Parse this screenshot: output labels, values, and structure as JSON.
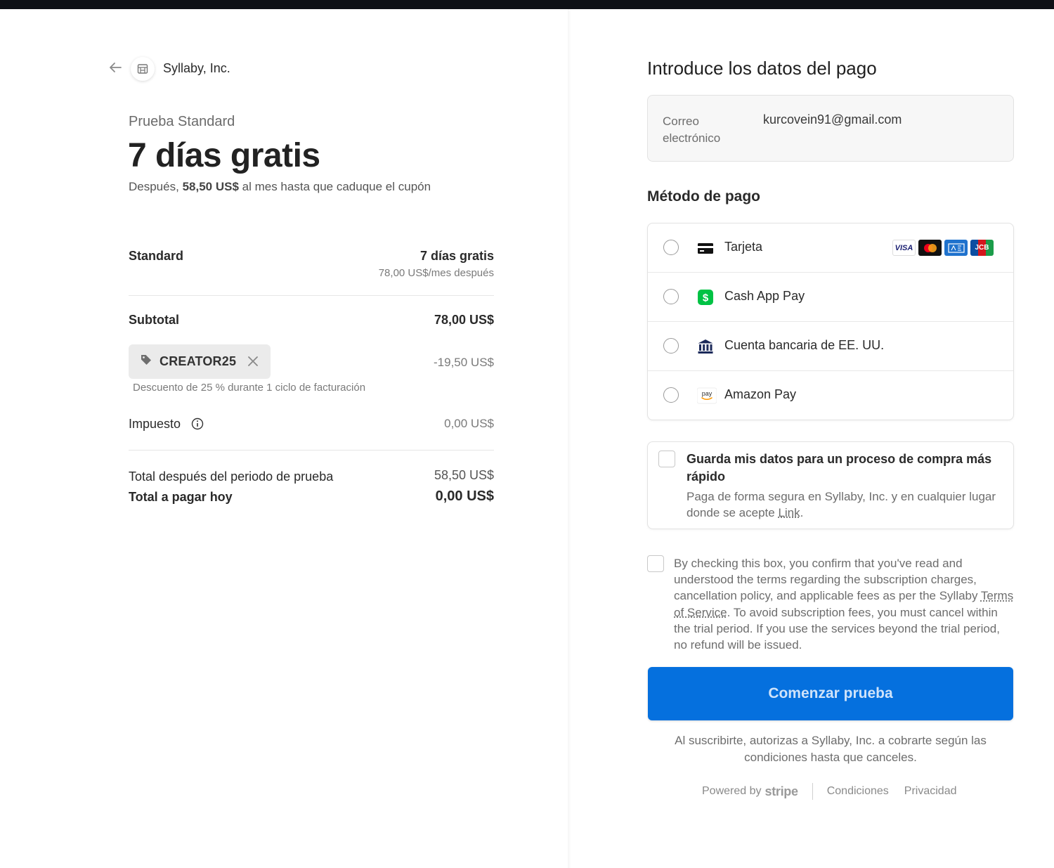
{
  "merchant": {
    "name": "Syllaby, Inc."
  },
  "summary": {
    "product_label": "Prueba Standard",
    "headline": "7 días gratis",
    "after_prefix": "Después,",
    "after_amount": "58,50 US$",
    "after_suffix": "al mes hasta que caduque el cupón"
  },
  "line_item": {
    "name": "Standard",
    "price": "7 días gratis",
    "note": "78,00 US$/mes después"
  },
  "subtotal": {
    "label": "Subtotal",
    "value": "78,00 US$"
  },
  "promo": {
    "code": "CREATOR25",
    "amount": "-19,50 US$",
    "description": "Descuento de 25 % durante 1 ciclo de facturación"
  },
  "tax": {
    "label": "Impuesto",
    "value": "0,00 US$"
  },
  "totals": {
    "after_trial_label": "Total después del periodo de prueba",
    "after_trial_value": "58,50 US$",
    "today_label": "Total a pagar hoy",
    "today_value": "0,00 US$"
  },
  "payment": {
    "title": "Introduce los datos del pago",
    "email_label": "Correo electrónico",
    "email_value": "kurcovein91@gmail.com",
    "method_title": "Método de pago",
    "methods": [
      {
        "label": "Tarjeta",
        "icon": "credit-card-icon"
      },
      {
        "label": "Cash App Pay",
        "icon": "cash-app-icon"
      },
      {
        "label": "Cuenta bancaria de EE. UU.",
        "icon": "bank-icon"
      },
      {
        "label": "Amazon Pay",
        "icon": "amazon-pay-icon"
      }
    ],
    "card_brands": [
      "VISA",
      "mastercard",
      "amex",
      "JCB"
    ]
  },
  "save_info": {
    "title": "Guarda mis datos para un proceso de compra más rápido",
    "desc_prefix": "Paga de forma segura en Syllaby, Inc. y en cualquier lugar donde se acepte ",
    "desc_link": "Link",
    "desc_suffix": "."
  },
  "terms": {
    "part1": "By checking this box, you confirm that you've read and understood the terms regarding the subscription charges, cancellation policy, and applicable fees as per the Syllaby ",
    "link": "Terms of Service",
    "part2": ". To avoid subscription fees, you must cancel within the trial period. If you use the services beyond the trial period, no refund will be issued."
  },
  "cta": {
    "label": "Comenzar prueba"
  },
  "authorization": "Al suscribirte, autorizas a Syllaby, Inc. a cobrarte según las condiciones hasta que canceles.",
  "footer": {
    "powered_by": "Powered by",
    "stripe": "stripe",
    "terms": "Condiciones",
    "privacy": "Privacidad"
  },
  "colors": {
    "accent": "#0570de",
    "cashapp": "#00c244",
    "topbar": "#0e1116"
  }
}
